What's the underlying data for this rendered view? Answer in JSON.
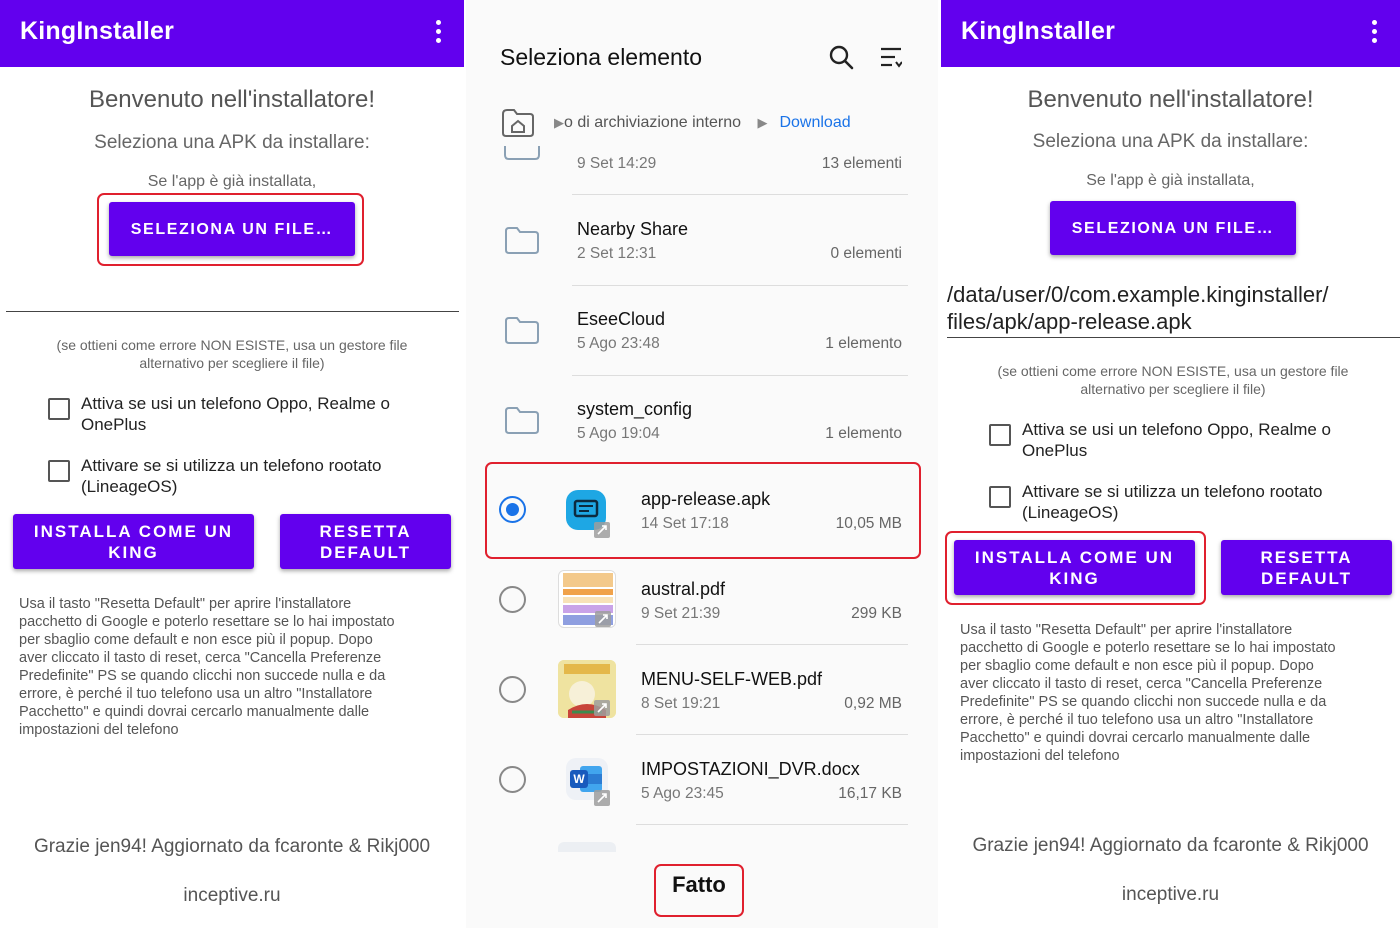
{
  "app": {
    "title": "KingInstaller",
    "welcome": "Benvenuto nell'installatore!",
    "select_apk": "Seleziona una APK da installare:",
    "already_installed": "Se l'app è già installata,",
    "select_file_button": "SELEZIONA UN FILE…",
    "error_note_line1": "(se ottieni come errore NON ESISTE, usa un gestore file",
    "error_note_line2": "alternativo per scegliere il file)",
    "checkbox_oppo_line1": "Attiva se usi un telefono Oppo, Realme o",
    "checkbox_oppo_line2": "OnePlus",
    "checkbox_root_line1": "Attivare se si utilizza un telefono rootato",
    "checkbox_root_line2": "(LineageOS)",
    "install_king_line1": "INSTALLA COME UN",
    "install_king_line2": "KING",
    "reset_default_line1": "RESETTA",
    "reset_default_line2": "DEFAULT",
    "help_lines": [
      "Usa il tasto \"Resetta Default\" per aprire l'installatore",
      "pacchetto di Google e poterlo resettare se lo hai impostato",
      "per sbaglio come default e non esce più il popup. Dopo",
      "aver cliccato il tasto di reset, cerca \"Cancella Preferenze",
      "Predefinite\" PS se quando clicchi non succede nulla e da",
      "errore, è perché il tuo telefono usa un altro \"Installatore",
      "Pacchetto\" e quindi dovrai cercarlo manualmente dalle",
      "impostazioni del telefono"
    ],
    "credits": "Grazie jen94! Aggiornato da fcaronte & Rikj000",
    "site": "inceptive.ru",
    "selected_path_line1": "/data/user/0/com.example.kinginstaller/",
    "selected_path_line2": "files/apk/app-release.apk"
  },
  "picker": {
    "title": "Seleziona elemento",
    "search_icon": "search-icon",
    "sort_icon": "sort-icon",
    "breadcrumb_parent": "o di archiviazione interno",
    "breadcrumb_current": "Download",
    "partial_row": {
      "date": "9 Set 14:29",
      "meta": "13 elementi"
    },
    "folders": [
      {
        "name": "Nearby Share",
        "date": "2 Set 12:31",
        "meta": "0 elementi"
      },
      {
        "name": "EseeCloud",
        "date": "5 Ago 23:48",
        "meta": "1 elemento"
      },
      {
        "name": "system_config",
        "date": "5 Ago 19:04",
        "meta": "1 elemento"
      }
    ],
    "files": [
      {
        "name": "app-release.apk",
        "date": "14 Set 17:18",
        "meta": "10,05 MB",
        "selected": true
      },
      {
        "name": "austral.pdf",
        "date": "9 Set 21:39",
        "meta": "299 KB",
        "selected": false
      },
      {
        "name": "MENU-SELF-WEB.pdf",
        "date": "8 Set 19:21",
        "meta": "0,92 MB",
        "selected": false
      },
      {
        "name": "IMPOSTAZIONI_DVR.docx",
        "date": "5 Ago 23:45",
        "meta": "16,17 KB",
        "selected": false
      }
    ],
    "done_button": "Fatto"
  },
  "colors": {
    "primary": "#6200ee",
    "highlight": "#e0202e",
    "link": "#1a73e8"
  }
}
